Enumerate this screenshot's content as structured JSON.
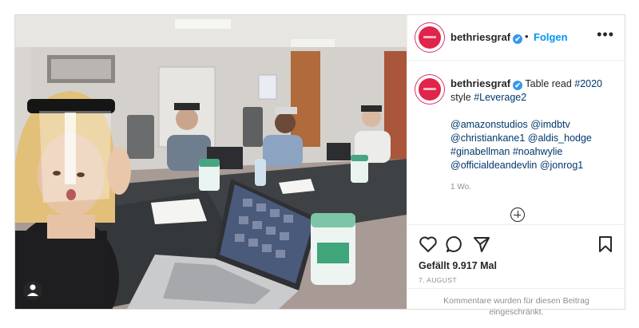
{
  "post": {
    "username": "bethriesgraf",
    "verified_badge": "✔",
    "separator": "•",
    "follow_label": "Folgen",
    "more_label": "•••",
    "caption": {
      "username": "bethriesgraf",
      "text_1": "Table read",
      "hashtag_2020": "#2020",
      "text_2": "style",
      "hashtag_leverage": "#Leverage2",
      "mentions": "@amazonstudios @imdbtv @christiankane1 @aldis_hodge #ginabellman #noahwylie @officialdeandevlin @jonrog1",
      "timestamp": "1 Wo."
    },
    "likes_text": "Gefällt 9.917 Mal",
    "date_text": "7. AUGUST",
    "comments_disabled_line1": "Kommentare wurden für diesen Beitrag",
    "comments_disabled_line2": "eingeschränkt."
  },
  "icons": {
    "like": "heart-icon",
    "comment": "comment-icon",
    "share": "share-icon",
    "save": "bookmark-icon",
    "add_comment": "plus-circle-icon",
    "tagged_user": "user-tag-icon"
  },
  "colors": {
    "link": "#00376b",
    "follow": "#0095f6",
    "verified": "#3897f0",
    "muted": "#8e8e8e"
  }
}
